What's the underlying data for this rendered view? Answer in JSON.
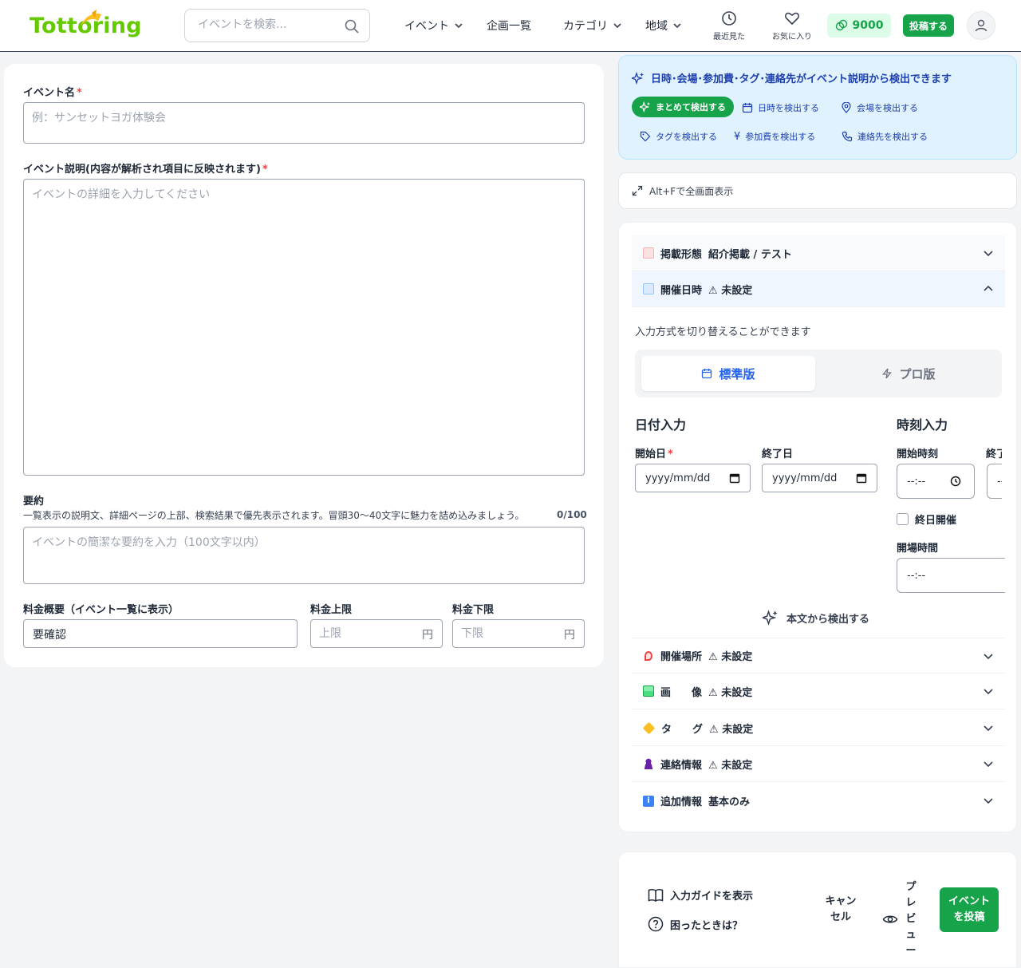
{
  "header": {
    "logo_text": "Tottoring",
    "search_placeholder": "イベントを検索...",
    "nav": [
      {
        "label": "イベント"
      },
      {
        "label": "企画一覧"
      },
      {
        "label": "カテゴリ"
      },
      {
        "label": "地域"
      }
    ],
    "recent_label": "最近見た",
    "favorites_label": "お気に入り",
    "points_value": "9000",
    "post_label": "投稿する",
    "colors": {
      "brand": "#65c900",
      "accent": "#16a34a"
    }
  },
  "form": {
    "event_name_label": "イベント名",
    "event_name_placeholder": "例：サンセットヨガ体験会",
    "required_mark": "*",
    "description_label": "イベント説明(内容が解析され項目に反映されます)",
    "description_placeholder": "イベントの詳細を入力してください",
    "summary_label": "要約",
    "summary_hint": "一覧表示の説明文、詳細ページの上部、検索結果で優先表示されます。冒頭30〜40文字に魅力を詰め込みましょう。",
    "summary_counter": "0/100",
    "summary_placeholder": "イベントの簡潔な要約を入力（100文字以内）",
    "fee_label": "料金概要（イベント一覧に表示）",
    "fee_value": "要確認",
    "fee_max_label": "料金上限",
    "fee_max_placeholder": "上限",
    "fee_min_label": "料金下限",
    "fee_min_placeholder": "下限",
    "yen": "円"
  },
  "detect": {
    "title": "日時･会場･参加費･タグ･連絡先がイベント説明から検出できます",
    "all": "まとめて検出する",
    "date": "日時を検出する",
    "venue": "会場を検出する",
    "tag": "タグを検出する",
    "fee": "参加費を検出する",
    "contact": "連絡先を検出する"
  },
  "fullscreen_hint": "Alt+Fで全画面表示",
  "accordion": {
    "format": {
      "label": "掲載形態",
      "value": "紹介掲載 / テスト"
    },
    "datetime": {
      "label": "開催日時",
      "value": "⚠ 未設定"
    },
    "mode_hint": "入力方式を切り替えることができます",
    "tab_standard": "標準版",
    "tab_pro": "プロ版",
    "date_section": "日付入力",
    "time_section": "時刻入力",
    "start_date_label": "開始日",
    "end_date_label": "終了日",
    "date_placeholder": "yyyy/mm/dd",
    "start_time_label": "開始時刻",
    "end_time_label": "終了",
    "time_placeholder": "--:--",
    "allday_label": "終日開催",
    "open_time_label": "開場時間",
    "detect_from_body": "本文から検出する",
    "venue": {
      "label": "開催場所",
      "value": "⚠ 未設定"
    },
    "image": {
      "label": "画　　像",
      "value": "⚠ 未設定"
    },
    "tag": {
      "label": "タ　　グ",
      "value": "⚠ 未設定"
    },
    "contact": {
      "label": "連絡情報",
      "value": "⚠ 未設定"
    },
    "extra": {
      "label": "追加情報",
      "value": "基本のみ"
    }
  },
  "footer": {
    "guide": "入力ガイドを表示",
    "help": "困ったときは？",
    "cancel": "キャンセル",
    "preview": "プレビュー",
    "submit": "イベントを投稿"
  }
}
